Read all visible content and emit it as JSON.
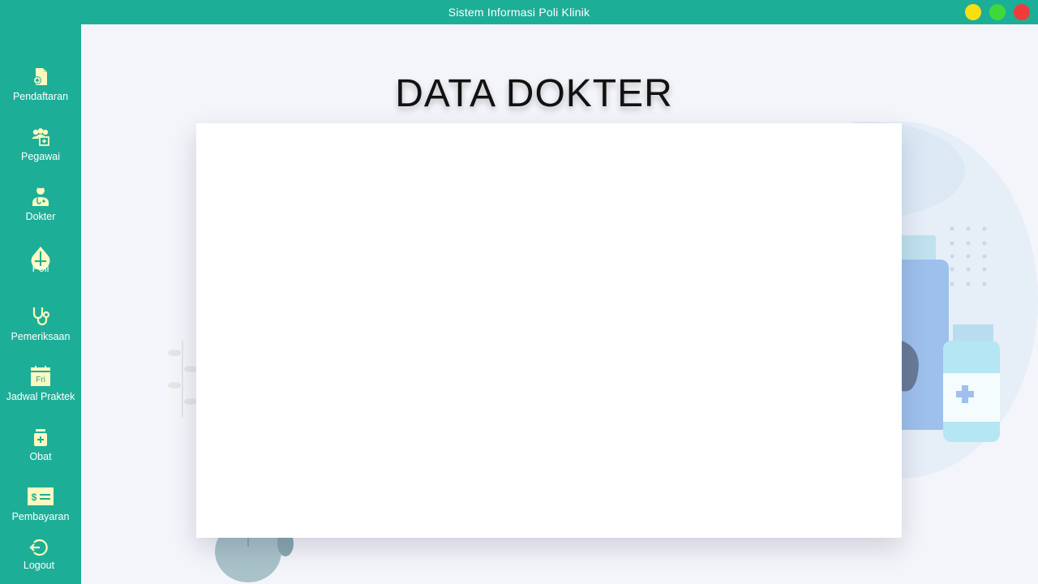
{
  "window": {
    "title": "Sistem Informasi Poli Klinik",
    "controls": [
      "minimize",
      "maximize",
      "close"
    ],
    "control_colors": {
      "minimize": "#f7df12",
      "maximize": "#3fd83a",
      "close": "#f13a3a"
    }
  },
  "theme": {
    "accent": "#1dae98",
    "icon_color": "#fcf8c0",
    "background": "#f4f5fa"
  },
  "sidebar": {
    "items": [
      {
        "label": "Pendaftaran",
        "icon": "registration-document-icon"
      },
      {
        "label": "Pegawai",
        "icon": "employees-icon"
      },
      {
        "label": "Dokter",
        "icon": "doctor-icon"
      },
      {
        "label": "Poli",
        "icon": "clinic-drop-icon"
      },
      {
        "label": "Pemeriksaan",
        "icon": "stethoscope-icon"
      },
      {
        "label": "Jadwal Praktek",
        "icon": "calendar-icon",
        "icon_text": "Fri"
      },
      {
        "label": "Obat",
        "icon": "medicine-bottle-icon"
      },
      {
        "label": "Pembayaran",
        "icon": "payment-bill-icon",
        "icon_text": "$"
      },
      {
        "label": "Logout",
        "icon": "logout-icon"
      }
    ]
  },
  "main": {
    "title": "DATA DOKTER"
  }
}
